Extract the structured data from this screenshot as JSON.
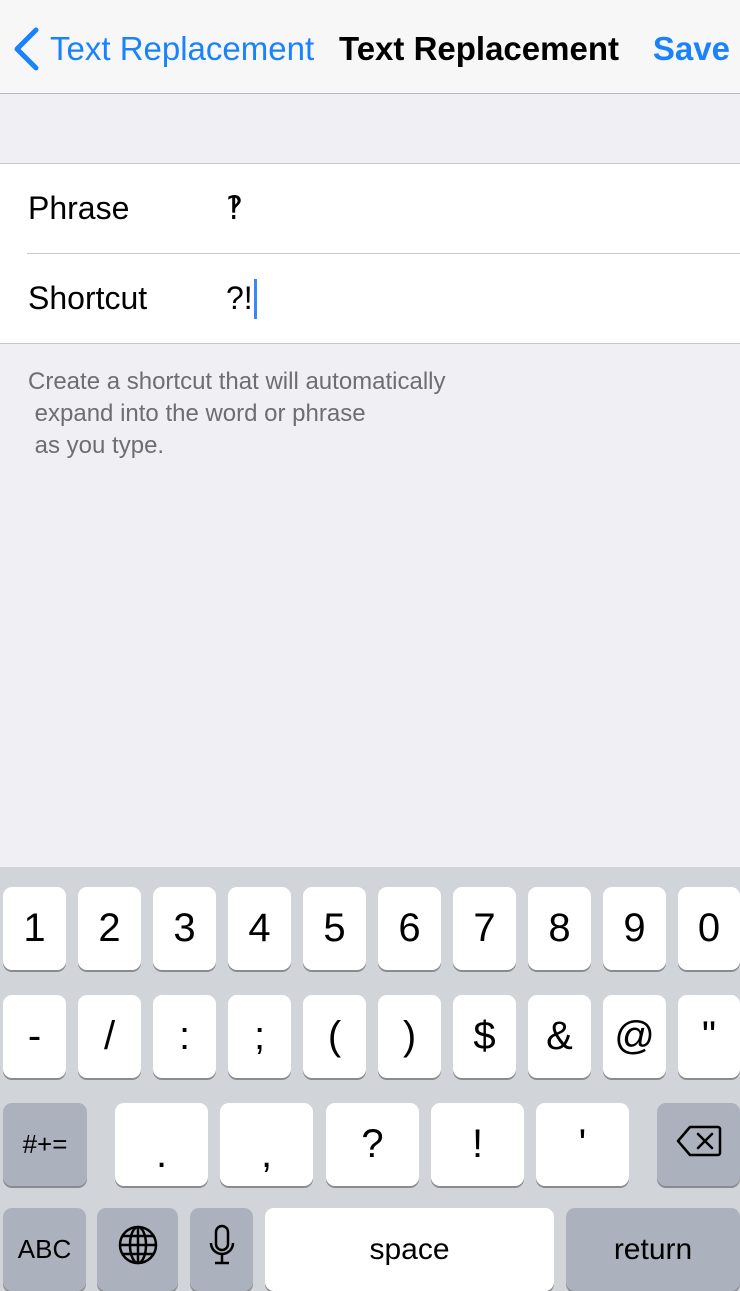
{
  "nav": {
    "back_label": "Text Replacement",
    "title": "Text Replacement",
    "save_label": "Save"
  },
  "form": {
    "phrase_label": "Phrase",
    "phrase_value": "‽",
    "shortcut_label": "Shortcut",
    "shortcut_value": "?!"
  },
  "footer_note": "Create a shortcut that will automatically\n expand into the word or phrase\n as you type.",
  "keyboard": {
    "row1": [
      "1",
      "2",
      "3",
      "4",
      "5",
      "6",
      "7",
      "8",
      "9",
      "0"
    ],
    "row2": [
      "-",
      "/",
      ":",
      ";",
      "(",
      ")",
      "$",
      "&",
      "@",
      "\""
    ],
    "row3_mode": "#+=",
    "row3": [
      ".",
      ",",
      "?",
      "!",
      "'"
    ],
    "abc_label": "ABC",
    "space_label": "space",
    "return_label": "return",
    "icons": [
      "globe-icon",
      "microphone-icon",
      "delete-icon",
      "chevron-left-icon"
    ]
  },
  "colors": {
    "accent": "#1a82fb",
    "background": "#efeff4",
    "keyboard": "#d1d4d9",
    "dark_key": "#abb2bd"
  }
}
